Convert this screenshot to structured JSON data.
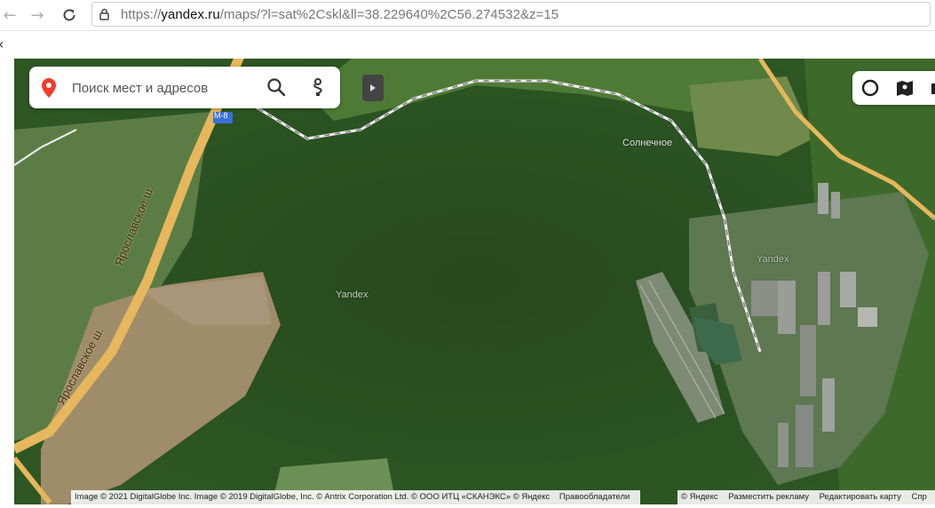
{
  "browser": {
    "back_icon": "arrow-left-icon",
    "forward_icon": "arrow-right-icon",
    "reload_icon": "reload-icon",
    "url_prefix": "https://",
    "url_host": "yandex.ru",
    "url_path": "/maps/?l=sat%2Cskl&ll=38.229640%2C56.274532&z=15"
  },
  "search": {
    "placeholder": "Поиск мест и адресов"
  },
  "map": {
    "layer": "satellite",
    "labels": {
      "road_sign": "М-8",
      "road_name_1": "Ярославское ш.",
      "road_name_2": "Ярославское ш.",
      "village": "Солнечное",
      "watermark_1": "Yandex",
      "watermark_2": "Yandex"
    }
  },
  "attribution": {
    "text": "Image © 2021 DigitalGlobe Inc. Image © 2019 DigitalGlobe, Inc. © Antrix Corporation Ltd. © ООО ИТЦ «СКАНЭКС» © Яндекс",
    "rights": "Правообладатели"
  },
  "footer_links": {
    "copyright": "© Яндекс",
    "advertise": "Разместить рекламу",
    "edit": "Редактировать карту",
    "help": "Спр"
  },
  "colors": {
    "forest": "#2f5a25",
    "road": "#e6b75c",
    "accent_red": "#f23a2e"
  }
}
